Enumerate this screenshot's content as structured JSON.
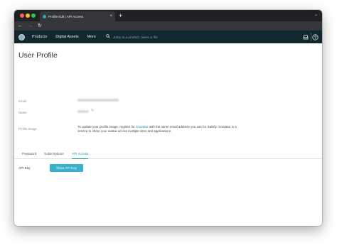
{
  "browser": {
    "tab_title": "Profile Edit | API Access",
    "tab_close": "×",
    "new_tab": "+",
    "menu": "⌄",
    "nav": {
      "back": "←",
      "forward": "→",
      "reload": "↻"
    }
  },
  "header": {
    "nav_items": [
      "Products",
      "Digital Assets",
      "More"
    ],
    "search_placeholder": "Jump to a product, asset or file",
    "icons": [
      "logo-icon",
      "search-icon",
      "inbox-icon",
      "help-icon"
    ]
  },
  "page": {
    "title": "User Profile",
    "fields": {
      "email_label": "Email",
      "name_label": "Name",
      "profile_image_label": "Profile Image"
    },
    "gravatar": {
      "before": "To update your profile image, register for ",
      "link": "Gravatar",
      "after": " with the same email address you use for Salsify. Gravatar is a service to share your avatar across multiple sites and applications."
    },
    "tabs": [
      "Password",
      "Subscriptions",
      "API Access"
    ],
    "active_tab": "API Access",
    "api_key_label": "API Key",
    "show_api_key_button": "Show API Key"
  },
  "colors": {
    "header_bg": "#13272e",
    "accent": "#1a96b3",
    "button": "#3ab0cf"
  }
}
